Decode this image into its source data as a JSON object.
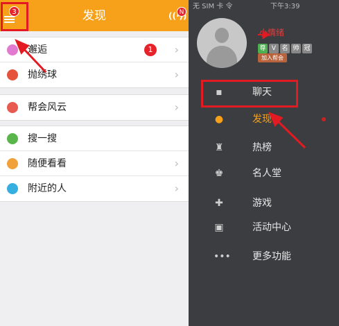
{
  "left": {
    "title": "发现",
    "menu_badge": "3",
    "notify_badge": "N",
    "groups": [
      {
        "items": [
          {
            "label": "邂逅",
            "badge": "1",
            "icon": "flower-icon",
            "color": "#e27bd0"
          },
          {
            "label": "抛绣球",
            "icon": "ball-icon",
            "color": "#e5533c"
          }
        ]
      },
      {
        "items": [
          {
            "label": "帮会风云",
            "icon": "group-icon",
            "color": "#e85a4f"
          }
        ]
      },
      {
        "items": [
          {
            "label": "搜一搜",
            "icon": "search-icon",
            "color": "#5ab54a"
          },
          {
            "label": "随便看看",
            "icon": "pin-icon",
            "color": "#f0a13a"
          },
          {
            "label": "附近的人",
            "icon": "location-icon",
            "color": "#35aee0"
          }
        ]
      }
    ]
  },
  "right": {
    "carrier": "无 SIM 卡 令",
    "time": "下午3:39",
    "nickname": "小情绪",
    "vip_tags": [
      "尊",
      "V",
      "名",
      "帅",
      "冠"
    ],
    "join_label": "加入帮会",
    "nav": [
      {
        "label": "聊天",
        "icon": "chat-icon",
        "glyph": "▪",
        "active": false
      },
      {
        "label": "发现",
        "icon": "location-pin-icon",
        "glyph": "●",
        "active": true
      },
      {
        "label": "热榜",
        "icon": "trophy-icon",
        "glyph": "♜",
        "active": false
      },
      {
        "label": "名人堂",
        "icon": "crown-icon",
        "glyph": "♚",
        "active": false
      },
      {
        "label": "游戏",
        "icon": "gamepad-icon",
        "glyph": "✚",
        "active": false
      },
      {
        "label": "活动中心",
        "icon": "gift-icon",
        "glyph": "▣",
        "active": false
      },
      {
        "label": "更多功能",
        "icon": "more-icon",
        "glyph": "•••",
        "active": false
      }
    ]
  },
  "colors": {
    "accent": "#f7a11a",
    "annotation": "#e21a22",
    "drawer_bg": "#3c3d41"
  }
}
